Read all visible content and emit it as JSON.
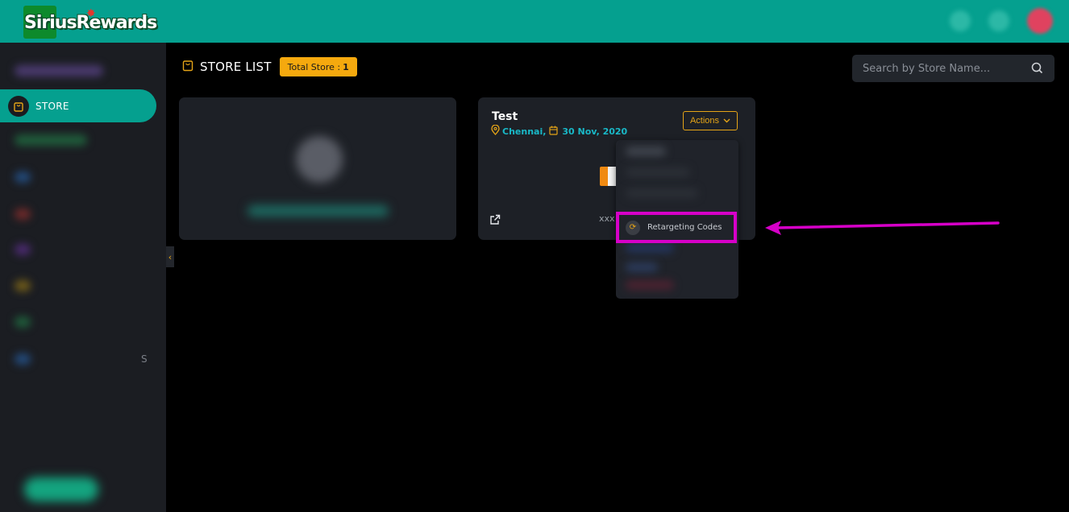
{
  "header": {
    "logo_text": "SiriusRewards"
  },
  "sidebar": {
    "active_item": "STORE",
    "collapse_icon": "chevron-left-icon",
    "partial_label": "S"
  },
  "page": {
    "title": "STORE LIST",
    "total_label": "Total Store :",
    "total_count": "1"
  },
  "search": {
    "placeholder": "Search by Store Name..."
  },
  "store_card": {
    "name": "Test",
    "location": "Chennai,",
    "date": "30 Nov, 2020",
    "actions_label": "Actions",
    "code": "xxx"
  },
  "actions_menu": {
    "highlighted_item": "Retargeting Codes"
  },
  "colors": {
    "brand": "#05a08f",
    "accent": "#f5a90e",
    "highlight": "#d600c8"
  }
}
